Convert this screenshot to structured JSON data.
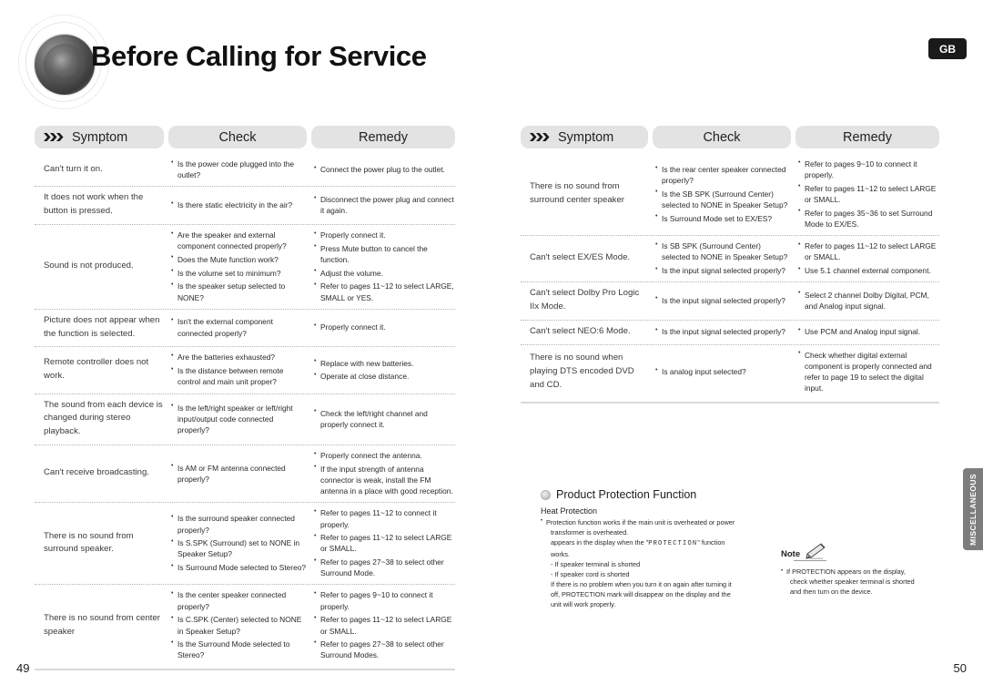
{
  "header": {
    "title": "Before Calling for Service",
    "lang_badge": "GB",
    "logo_icon": "speaker-cone-icon"
  },
  "side_tab": {
    "label": "MISCELLANEOUS"
  },
  "footer": {
    "left_page": "49",
    "right_page": "50"
  },
  "columns": {
    "symptom": "Symptom",
    "check": "Check",
    "remedy": "Remedy"
  },
  "symptom_icon": "triple-chevron-icon",
  "left_table": {
    "rows": [
      {
        "symptom": "Can't turn it on.",
        "check": [
          "Is the power code plugged into the outlet?"
        ],
        "remedy": [
          "Connect the power plug to the outlet."
        ]
      },
      {
        "symptom": "It does not work when the button is pressed.",
        "check": [
          "Is there static electricity in the air?"
        ],
        "remedy": [
          "Disconnect the power plug and connect it again."
        ]
      },
      {
        "symptom": "Sound is not produced.",
        "check": [
          "Are the speaker and external component connected properly?",
          "Does the Mute function work?",
          "Is the volume set to minimum?",
          "Is the speaker setup selected to NONE?"
        ],
        "remedy": [
          "Properly connect it.",
          "Press Mute button to cancel the function.",
          "Adjust the volume.",
          "Refer to pages 11~12 to select LARGE, SMALL or YES."
        ]
      },
      {
        "symptom": "Picture does not appear when the function is selected.",
        "check": [
          "Isn't the external component connected properly?"
        ],
        "remedy": [
          "Properly connect it."
        ]
      },
      {
        "symptom": "Remote controller does not work.",
        "check": [
          "Are the batteries exhausted?",
          "Is the distance between remote control and main unit proper?"
        ],
        "remedy": [
          "Replace with new batteries.",
          "Operate at close distance."
        ]
      },
      {
        "symptom": "The sound from each device is changed during stereo playback.",
        "check": [
          "Is the left/right speaker or left/right input/output code connected properly?"
        ],
        "remedy": [
          "Check the left/right channel and properly connect it."
        ]
      },
      {
        "symptom": "Can't receive broadcasting.",
        "check": [
          "Is AM or FM antenna connected properly?"
        ],
        "remedy": [
          "Properly connect the antenna.",
          "If the input strength of antenna connector is weak, install the FM antenna in a place with good reception."
        ]
      },
      {
        "symptom": "There is no sound from surround speaker.",
        "check": [
          "Is the surround speaker connected properly?",
          "Is  S.SPK (Surround) set to NONE in Speaker Setup?",
          "Is Surround Mode selected to Stereo?"
        ],
        "remedy": [
          "Refer to pages 11~12 to connect it properly.",
          "Refer to pages 11~12 to select LARGE or SMALL.",
          "Refer to pages 27~38 to select other Surround Mode."
        ]
      },
      {
        "symptom": "There is no sound from center speaker",
        "check": [
          "Is the center speaker connected properly?",
          "Is C.SPK (Center) selected to NONE in Speaker Setup?",
          "Is the Surround Mode selected to Stereo?"
        ],
        "remedy": [
          "Refer to pages 9~10 to connect it properly.",
          "Refer to pages 11~12 to select LARGE or SMALL.",
          "Refer to pages 27~38 to select other Surround Modes."
        ]
      }
    ]
  },
  "right_table": {
    "rows": [
      {
        "symptom": "There is no sound from surround center speaker",
        "check": [
          "Is the rear center speaker connected properly?",
          "Is the SB SPK (Surround Center) selected to NONE in Speaker Setup?",
          "Is Surround Mode set to EX/ES?"
        ],
        "remedy": [
          "Refer to pages 9~10 to connect it properly.",
          "Refer to pages 11~12 to select LARGE or SMALL.",
          "Refer to pages 35~36 to set Surround Mode to EX/ES."
        ]
      },
      {
        "symptom": "Can't select EX/ES Mode.",
        "check": [
          "Is SB SPK (Surround Center) selected to NONE in Speaker Setup?",
          "Is the input signal selected properly?"
        ],
        "remedy": [
          "Refer to pages 11~12 to select LARGE or SMALL.",
          "Use 5.1 channel external component."
        ]
      },
      {
        "symptom": "Can't select Dolby Pro Logic IIx Mode.",
        "check": [
          "Is the input signal selected properly?"
        ],
        "remedy": [
          "Select 2 channel Dolby Digital, PCM, and Analog input signal."
        ]
      },
      {
        "symptom": "Can't select NEO:6 Mode.",
        "check": [
          "Is the input signal selected properly?"
        ],
        "remedy": [
          "Use PCM and Analog input signal."
        ]
      },
      {
        "symptom": "There is no sound when playing DTS encoded DVD and CD.",
        "check": [
          "Is analog input selected?"
        ],
        "remedy": [
          "Check whether digital external component is properly connected and refer to page 19 to select the digital input."
        ]
      }
    ]
  },
  "product_protection": {
    "title": "Product Protection Function",
    "subtitle": "Heat Protection",
    "line1": "Protection function works if the main unit is overheated or power",
    "line2": "transformer is overheated.",
    "line3_pre": "appears in the display when the \"",
    "line3_mono": "PROTECTION",
    "line3_post": "\" function",
    "line4": "works.",
    "dash1": "- If speaker terminal is shorted",
    "dash2": "- If speaker cord is shorted",
    "line5": "If there is no problem when you turn it on again after turning it",
    "line6": "off, PROTECTION mark will disappear on the display and the",
    "line7": "unit will work properly."
  },
  "note": {
    "label": "Note",
    "icon": "pencil-icon",
    "line1": "If PROTECTION appears on the display,",
    "line2": "check whether speaker terminal is shorted",
    "line3": "and then turn on the device."
  }
}
